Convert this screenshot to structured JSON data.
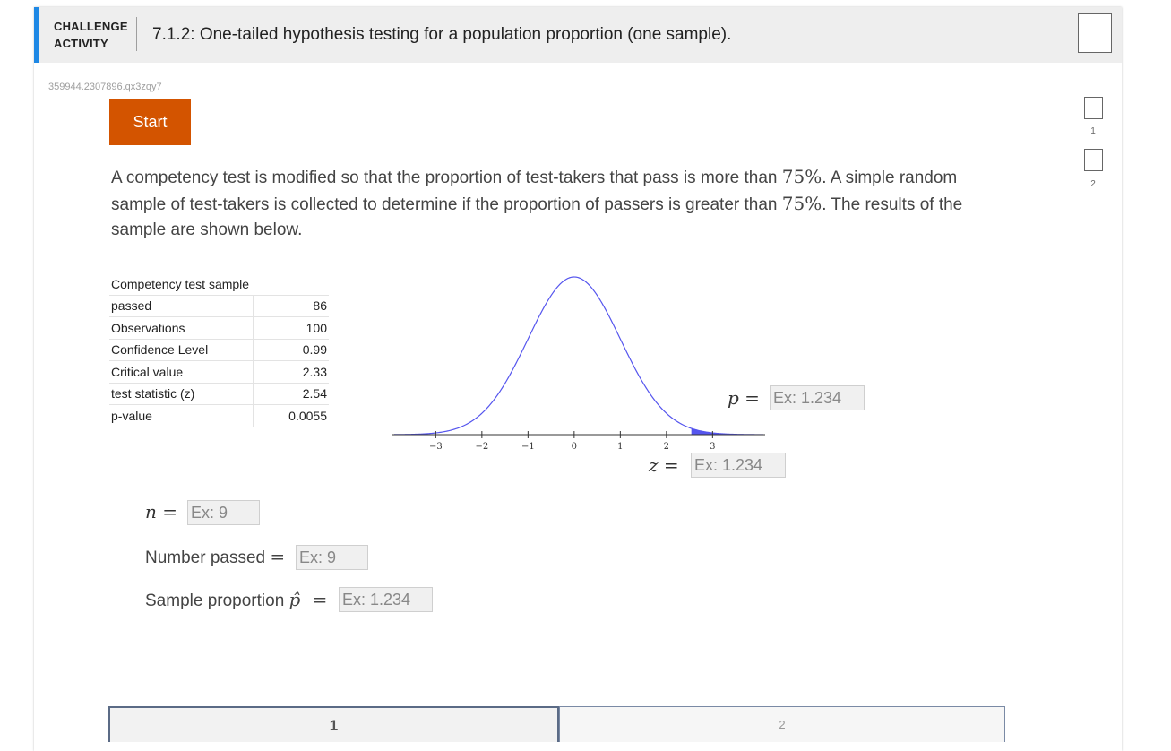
{
  "header": {
    "kind_line1": "CHALLENGE",
    "kind_line2": "ACTIVITY",
    "title": "7.1.2: One-tailed hypothesis testing for a population proportion (one sample)."
  },
  "activity_code": "359944.2307896.qx3zqy7",
  "start_label": "Start",
  "prompt": {
    "part1": "A competency test is modified so that the proportion of test-takers that pass is more than ",
    "pct1": "75%",
    "part2": ". A simple random sample of test-takers is collected to determine if the proportion of passers is greater than ",
    "pct2": "75%",
    "part3": ". The results of the sample are shown below."
  },
  "sample_table": {
    "title": "Competency test sample",
    "rows": [
      {
        "label": "passed",
        "value": "86"
      },
      {
        "label": "Observations",
        "value": "100"
      },
      {
        "label": "Confidence Level",
        "value": "0.99"
      },
      {
        "label": "Critical value",
        "value": "2.33"
      },
      {
        "label": "test statistic (z)",
        "value": "2.54"
      },
      {
        "label": "p-value",
        "value": "0.0055"
      }
    ]
  },
  "chart_data": {
    "type": "area",
    "description_ticks": [
      "−3",
      "−2",
      "−1",
      "0",
      "1",
      "2",
      "3"
    ],
    "x_ticks": [
      -3,
      -2,
      -1,
      0,
      1,
      2,
      3
    ],
    "xlim": [
      -3.9,
      4.1
    ],
    "shaded_from": 2.54,
    "curve_color": "#5555ee",
    "shade_color": "#5555ee"
  },
  "answers": {
    "p_label": "p",
    "z_label": "z",
    "n_label": "n",
    "equals": "=",
    "number_passed_label": "Number passed",
    "sample_proportion_label": "Sample proportion",
    "phat_symbol": "p̂",
    "p_placeholder": "Ex: 1.234",
    "z_placeholder": "Ex: 1.234",
    "n_placeholder": "Ex: 9",
    "passed_placeholder": "Ex: 9",
    "phat_placeholder": "Ex: 1.234"
  },
  "progress": {
    "levels": [
      "1",
      "2"
    ]
  },
  "tabs": [
    "1",
    "2"
  ],
  "colors": {
    "accent": "#1e88e5",
    "start_button": "#d35400"
  }
}
